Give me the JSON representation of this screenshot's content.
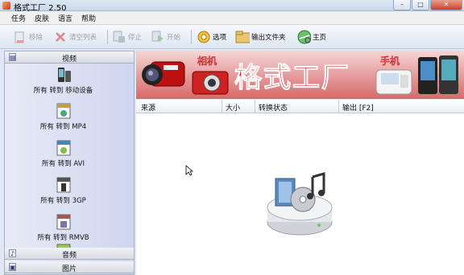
{
  "window": {
    "title": "格式工厂 2.50",
    "minimize": "–",
    "maximize": "□",
    "close": "✕"
  },
  "menu": [
    "任务",
    "皮肤",
    "语言",
    "帮助"
  ],
  "toolbar": {
    "remove": "移除",
    "clear": "清空列表",
    "stop": "停止",
    "start": "开始",
    "options": "选项",
    "output_folder": "输出文件夹",
    "home": "主页"
  },
  "sidebar": {
    "video_label": "视频",
    "audio_label": "音频",
    "image_label": "图片",
    "items": [
      {
        "label": "所有 转到 移动设备",
        "icon": "mobile-device-icon"
      },
      {
        "label": "所有 转到 MP4",
        "icon": "mp4-file-icon"
      },
      {
        "label": "所有 转到 AVI",
        "icon": "avi-file-icon"
      },
      {
        "label": "所有 转到 3GP",
        "icon": "3gp-file-icon"
      },
      {
        "label": "所有 转到 RMVB",
        "icon": "rmvb-file-icon"
      }
    ]
  },
  "banner": {
    "title": "格式工厂",
    "camera_label": "相机",
    "phone_label": "手机"
  },
  "columns": [
    "来源",
    "大小",
    "转换状态",
    "输出 [F2]"
  ],
  "colors": {
    "banner_red": "#cc1b12",
    "accent": "#3a6fb0"
  }
}
